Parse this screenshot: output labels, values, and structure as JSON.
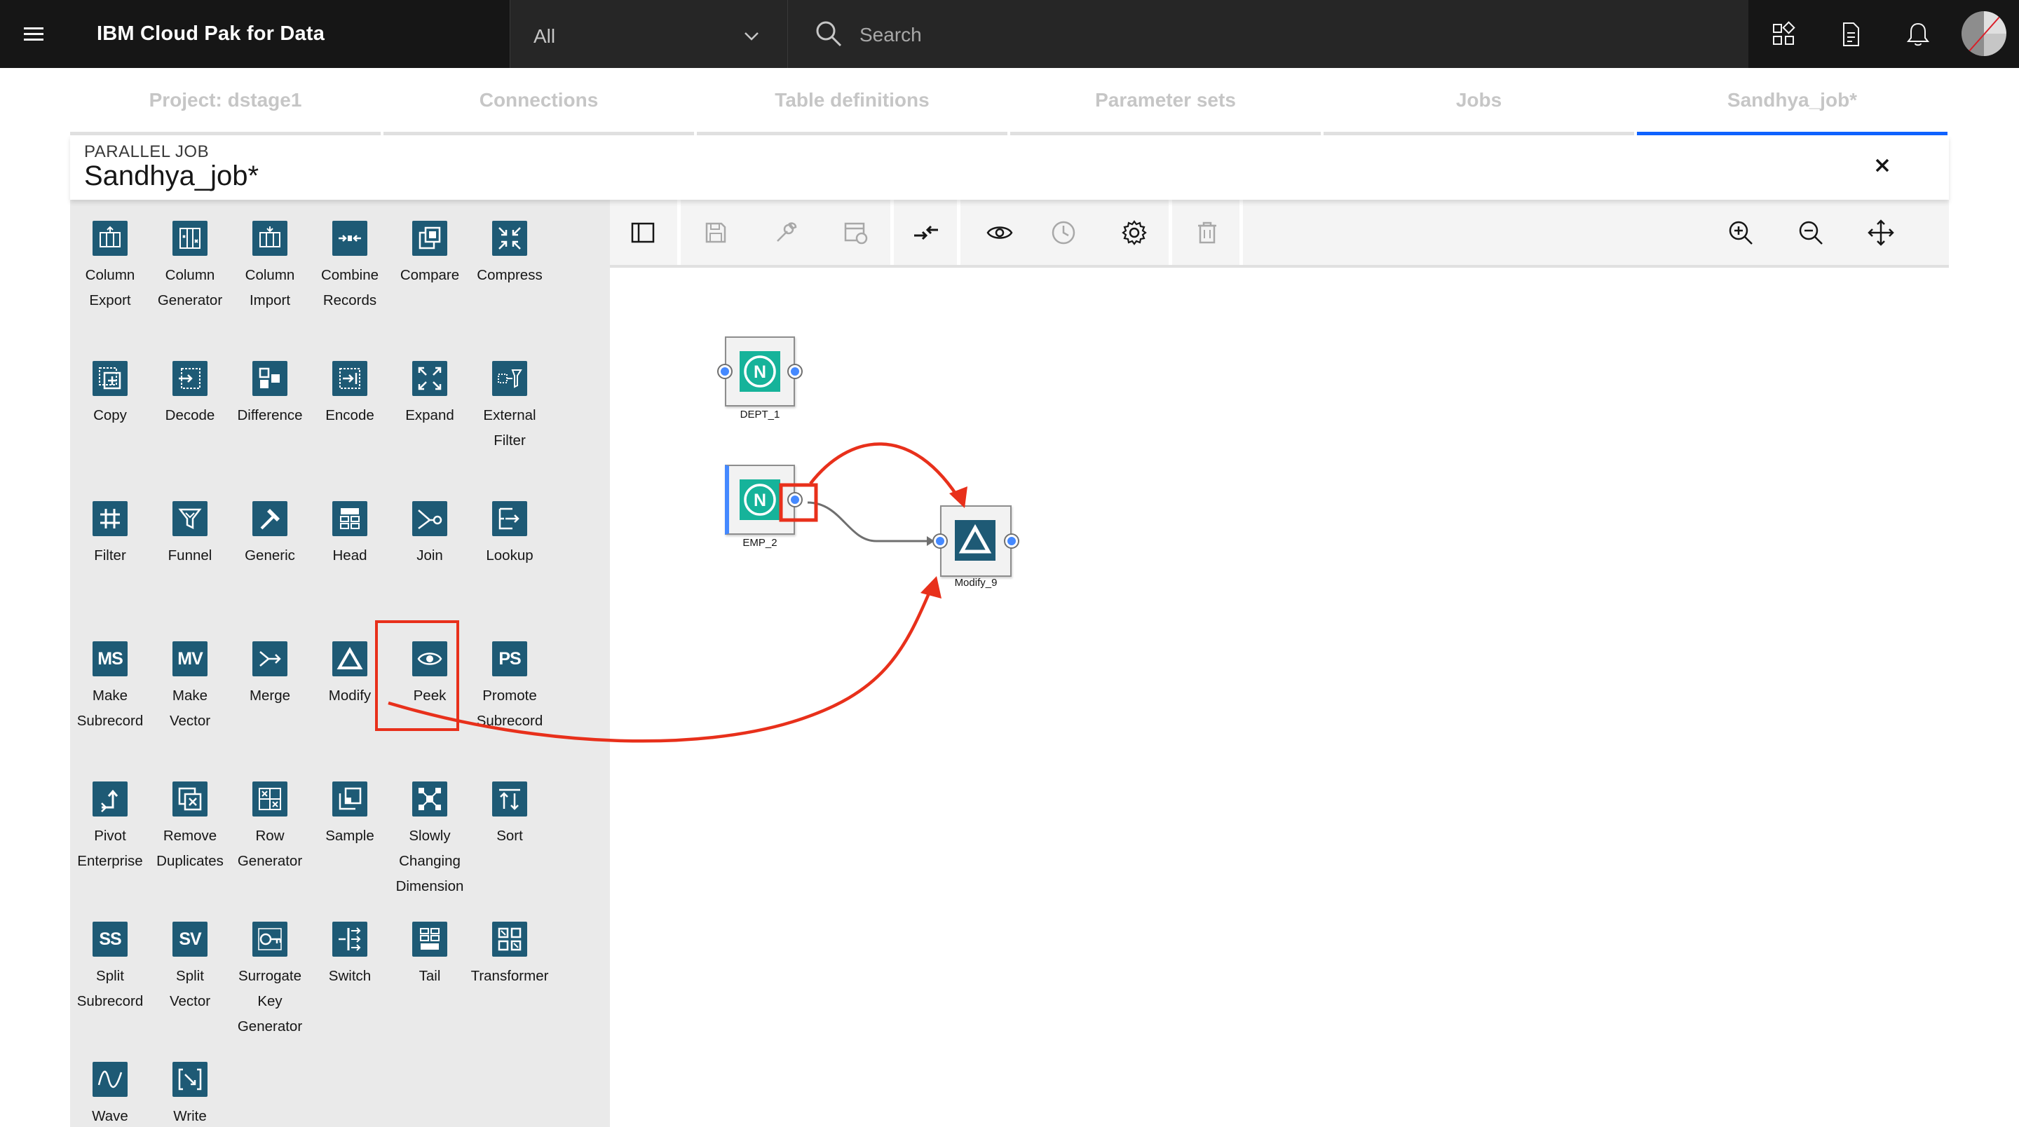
{
  "header": {
    "product_name": "IBM Cloud Pak for Data",
    "scope_selected": "All",
    "search_placeholder": "Search",
    "icons": [
      "menu-icon",
      "chevron-down-icon",
      "search-icon",
      "apps-icon",
      "document-icon",
      "notification-icon",
      "user-avatar"
    ]
  },
  "tabs": [
    {
      "label": "Project: dstage1",
      "active": false
    },
    {
      "label": "Connections",
      "active": false
    },
    {
      "label": "Table definitions",
      "active": false
    },
    {
      "label": "Parameter sets",
      "active": false
    },
    {
      "label": "Jobs",
      "active": false
    },
    {
      "label": "Sandhya_job*",
      "active": true
    }
  ],
  "job": {
    "type_label": "PARALLEL JOB",
    "title": "Sandhya_job*"
  },
  "palette": {
    "items": [
      {
        "line1": "Column",
        "line2": "Export",
        "line3": "",
        "icon": "column-export-icon"
      },
      {
        "line1": "Column",
        "line2": "Generator",
        "line3": "",
        "icon": "column-generator-icon"
      },
      {
        "line1": "Column",
        "line2": "Import",
        "line3": "",
        "icon": "column-import-icon"
      },
      {
        "line1": "Combine",
        "line2": "Records",
        "line3": "",
        "icon": "combine-records-icon"
      },
      {
        "line1": "Compare",
        "line2": "",
        "line3": "",
        "icon": "compare-icon"
      },
      {
        "line1": "Compress",
        "line2": "",
        "line3": "",
        "icon": "compress-icon"
      },
      {
        "line1": "Copy",
        "line2": "",
        "line3": "",
        "icon": "copy-icon"
      },
      {
        "line1": "Decode",
        "line2": "",
        "line3": "",
        "icon": "decode-icon"
      },
      {
        "line1": "Difference",
        "line2": "",
        "line3": "",
        "icon": "difference-icon"
      },
      {
        "line1": "Encode",
        "line2": "",
        "line3": "",
        "icon": "encode-icon"
      },
      {
        "line1": "Expand",
        "line2": "",
        "line3": "",
        "icon": "expand-icon"
      },
      {
        "line1": "External",
        "line2": "Filter",
        "line3": "",
        "icon": "external-filter-icon"
      },
      {
        "line1": "Filter",
        "line2": "",
        "line3": "",
        "icon": "filter-icon"
      },
      {
        "line1": "Funnel",
        "line2": "",
        "line3": "",
        "icon": "funnel-icon"
      },
      {
        "line1": "Generic",
        "line2": "",
        "line3": "",
        "icon": "generic-icon"
      },
      {
        "line1": "Head",
        "line2": "",
        "line3": "",
        "icon": "head-icon"
      },
      {
        "line1": "Join",
        "line2": "",
        "line3": "",
        "icon": "join-icon"
      },
      {
        "line1": "Lookup",
        "line2": "",
        "line3": "",
        "icon": "lookup-icon"
      },
      {
        "line1": "Make",
        "line2": "Subrecord",
        "line3": "",
        "icon": "make-subrecord-icon",
        "icon_text": "MS"
      },
      {
        "line1": "Make",
        "line2": "Vector",
        "line3": "",
        "icon": "make-vector-icon",
        "icon_text": "MV"
      },
      {
        "line1": "Merge",
        "line2": "",
        "line3": "",
        "icon": "merge-icon"
      },
      {
        "line1": "Modify",
        "line2": "",
        "line3": "",
        "icon": "modify-icon",
        "highlighted": true
      },
      {
        "line1": "Peek",
        "line2": "",
        "line3": "",
        "icon": "peek-icon"
      },
      {
        "line1": "Promote",
        "line2": "Subrecord",
        "line3": "",
        "icon": "promote-subrecord-icon",
        "icon_text": "PS"
      },
      {
        "line1": "Pivot",
        "line2": "Enterprise",
        "line3": "",
        "icon": "pivot-enterprise-icon"
      },
      {
        "line1": "Remove",
        "line2": "Duplicates",
        "line3": "",
        "icon": "remove-duplicates-icon"
      },
      {
        "line1": "Row",
        "line2": "Generator",
        "line3": "",
        "icon": "row-generator-icon"
      },
      {
        "line1": "Sample",
        "line2": "",
        "line3": "",
        "icon": "sample-icon"
      },
      {
        "line1": "Slowly",
        "line2": "Changing",
        "line3": "Dimension",
        "icon": "slowly-changing-dimension-icon"
      },
      {
        "line1": "Sort",
        "line2": "",
        "line3": "",
        "icon": "sort-icon"
      },
      {
        "line1": "Split",
        "line2": "Subrecord",
        "line3": "",
        "icon": "split-subrecord-icon",
        "icon_text": "SS"
      },
      {
        "line1": "Split",
        "line2": "Vector",
        "line3": "",
        "icon": "split-vector-icon",
        "icon_text": "SV"
      },
      {
        "line1": "Surrogate",
        "line2": "Key",
        "line3": "Generator",
        "icon": "surrogate-key-generator-icon"
      },
      {
        "line1": "Switch",
        "line2": "",
        "line3": "",
        "icon": "switch-icon"
      },
      {
        "line1": "Tail",
        "line2": "",
        "line3": "",
        "icon": "tail-icon"
      },
      {
        "line1": "Transformer",
        "line2": "",
        "line3": "",
        "icon": "transformer-icon"
      },
      {
        "line1": "Wave",
        "line2": "",
        "line3": "",
        "icon": "wave-icon"
      },
      {
        "line1": "Write",
        "line2": "",
        "line3": "",
        "icon": "write-icon"
      }
    ]
  },
  "toolbar": {
    "icons": [
      "sidebar-toggle-icon",
      "save-icon",
      "wrench-icon",
      "schedule-icon",
      "arrange-icon",
      "view-icon",
      "history-icon",
      "settings-icon",
      "delete-icon",
      "zoom-in-icon",
      "zoom-out-icon",
      "fit-to-screen-icon"
    ]
  },
  "canvas": {
    "nodes": [
      {
        "label": "DEPT_1",
        "icon": "netezza-connector-icon",
        "icon_text": "N"
      },
      {
        "label": "EMP_2",
        "icon": "netezza-connector-icon",
        "icon_text": "N"
      },
      {
        "label": "Modify_9",
        "icon": "modify-icon"
      }
    ],
    "links": [
      {
        "from": "EMP_2",
        "to": "Modify_9"
      }
    ]
  },
  "colors": {
    "header_bg": "#161616",
    "active_tab": "#0f62fe",
    "palette_icon": "#1e5a75",
    "connector_icon": "#16b39a",
    "annotation_red": "#e8301b",
    "port": "#4589ff"
  }
}
